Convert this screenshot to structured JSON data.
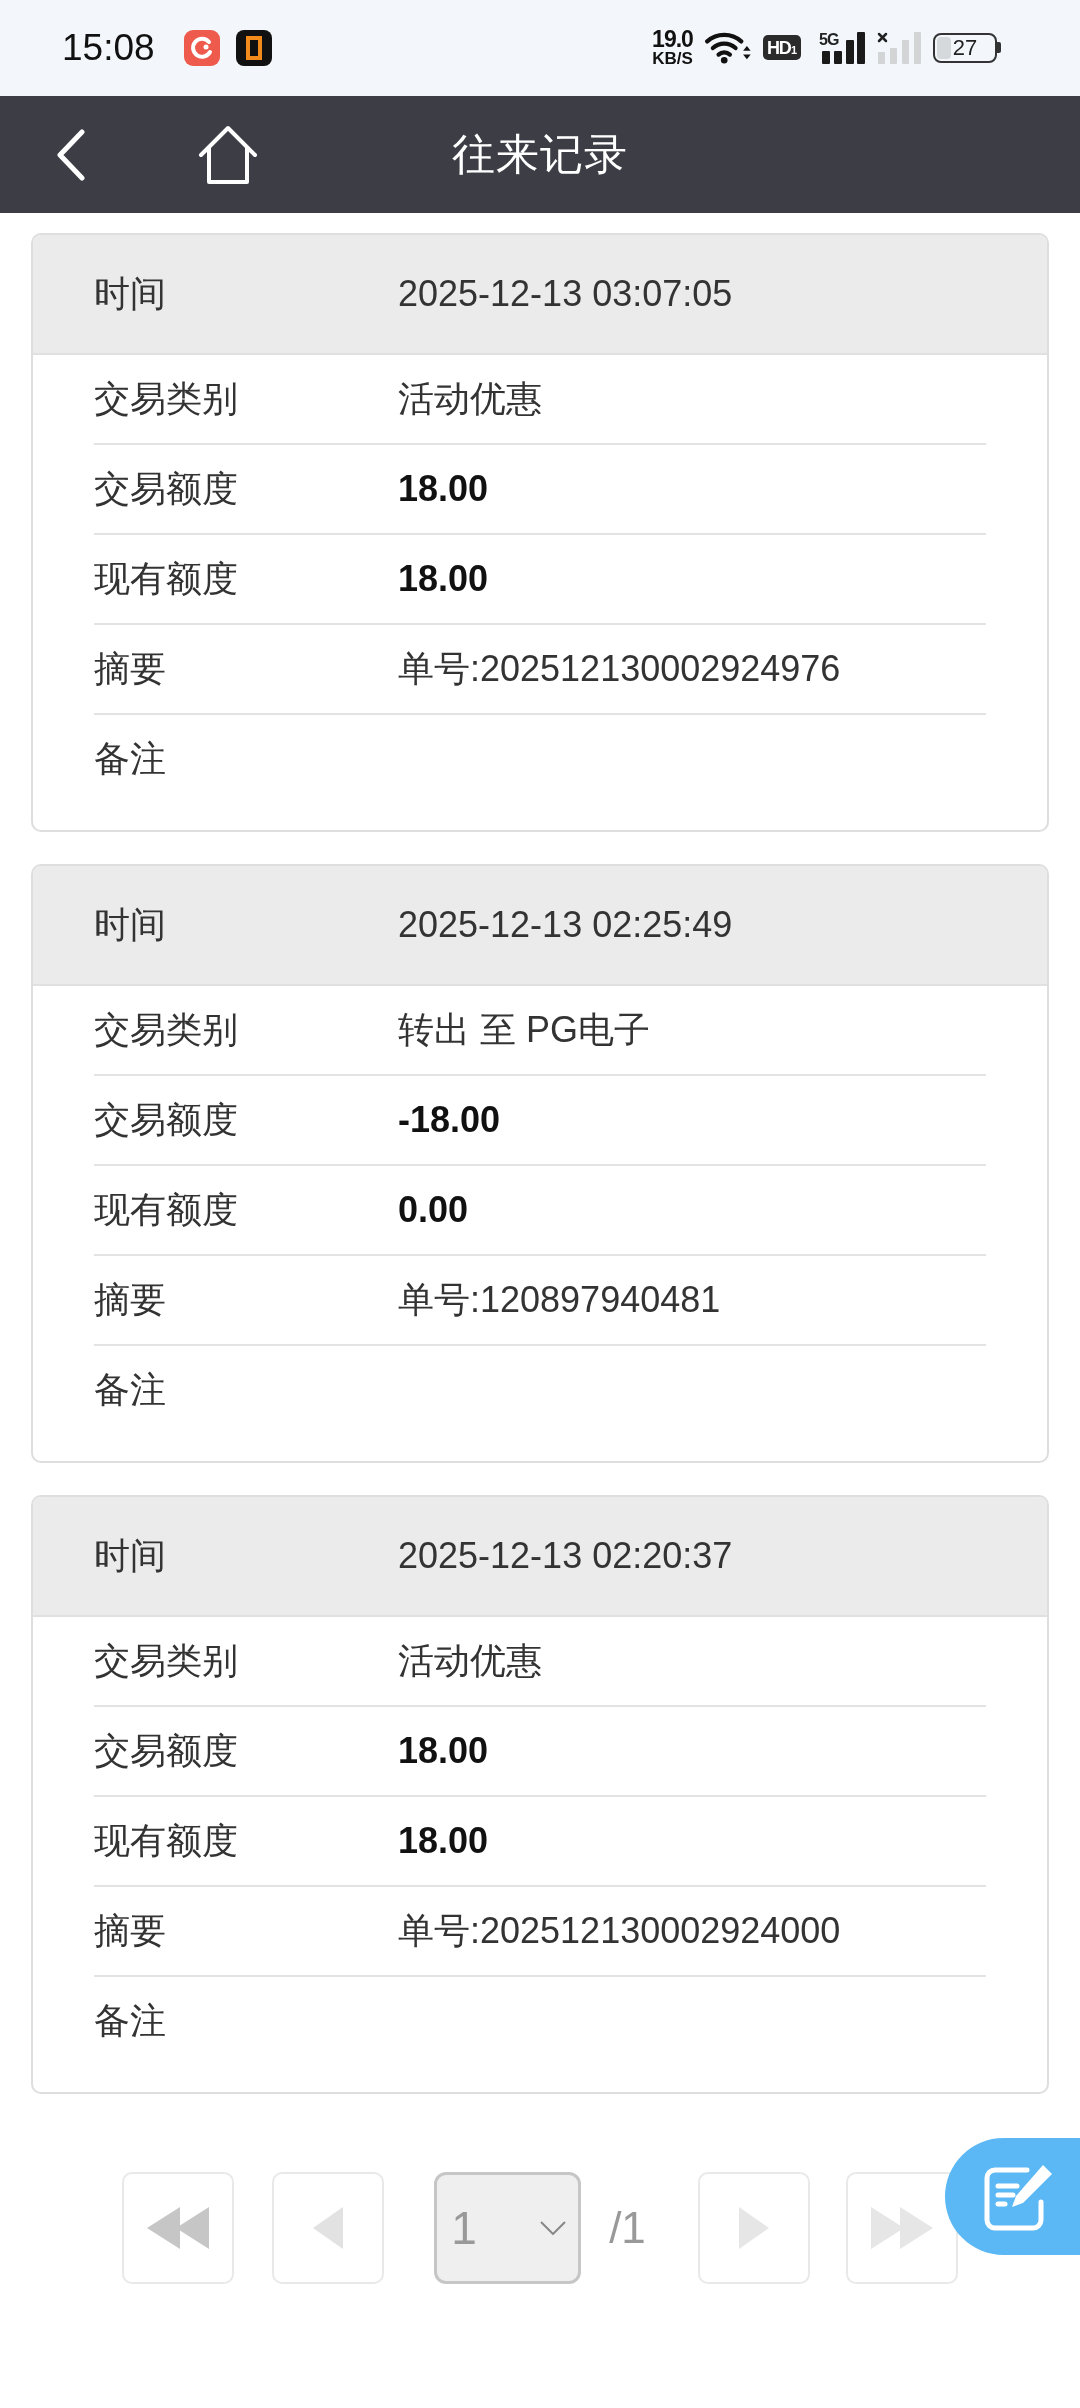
{
  "status_bar": {
    "time": "15:08",
    "speed_value": "19.0",
    "speed_unit": "KB/S",
    "hd_badge": "HD$_{1}$",
    "network_type": "5G",
    "battery": "27"
  },
  "header": {
    "title": "往来记录"
  },
  "records": [
    {
      "time_label": "时间",
      "time": "2025-12-13 03:07:05",
      "fields": [
        {
          "label": "交易类别",
          "value": "活动优惠"
        },
        {
          "label": "交易额度",
          "amount": "18.00"
        },
        {
          "label": "现有额度",
          "amount": "18.00"
        },
        {
          "label": "摘要",
          "value": "单号:202512130002924976"
        },
        {
          "label": "备注"
        }
      ]
    },
    {
      "time_label": "时间",
      "time": "2025-12-13 02:25:49",
      "fields": [
        {
          "label": "交易类别",
          "value": "转出 至 PG电子"
        },
        {
          "label": "交易额度",
          "amount": "-18.00"
        },
        {
          "label": "现有额度",
          "amount": "0.00"
        },
        {
          "label": "摘要",
          "value": "单号:120897940481"
        },
        {
          "label": "备注"
        }
      ]
    },
    {
      "time_label": "时间",
      "time": "2025-12-13 02:20:37",
      "fields": [
        {
          "label": "交易类别",
          "value": "活动优惠"
        },
        {
          "label": "交易额度",
          "amount": "18.00"
        },
        {
          "label": "现有额度",
          "amount": "18.00"
        },
        {
          "label": "摘要",
          "value": "单号:202512130002924000"
        },
        {
          "label": "备注"
        }
      ]
    }
  ],
  "pagination": {
    "controls": [
      {
        "kind": "first",
        "disabled": true
      },
      {
        "kind": "prev",
        "disabled": true
      },
      {
        "kind": "select",
        "value": "1",
        "disabled": true
      },
      {
        "kind": "total",
        "text": "/1"
      },
      {
        "kind": "next",
        "disabled": true
      },
      {
        "kind": "last",
        "disabled": true
      }
    ]
  }
}
